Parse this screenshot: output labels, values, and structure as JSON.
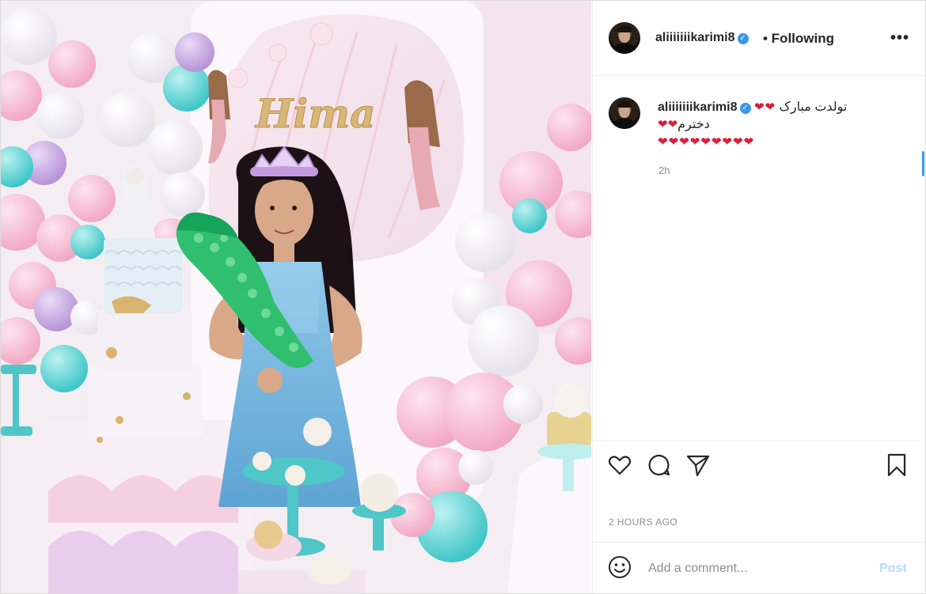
{
  "post": {
    "username": "aliiiiiiikarimi8",
    "follow_status": "• Following",
    "more_icon": "•••",
    "verified_icon": "✓"
  },
  "photo": {
    "sign_text": "Hima"
  },
  "caption": {
    "username": "aliiiiiiikarimi8",
    "line1_text": "تولدت مبارک",
    "line1_hearts": "❤❤",
    "line2_text": "دخترم",
    "line2_hearts": "❤❤",
    "line3_hearts": "❤❤❤❤❤❤❤❤❤",
    "time": "2h"
  },
  "footer": {
    "posted_ago": "2 HOURS AGO",
    "comment_placeholder": "Add a comment...",
    "post_label": "Post"
  },
  "colors": {
    "verified": "#3897f0",
    "post_disabled": "#b2dffc",
    "hearts": "#d81f3c"
  }
}
